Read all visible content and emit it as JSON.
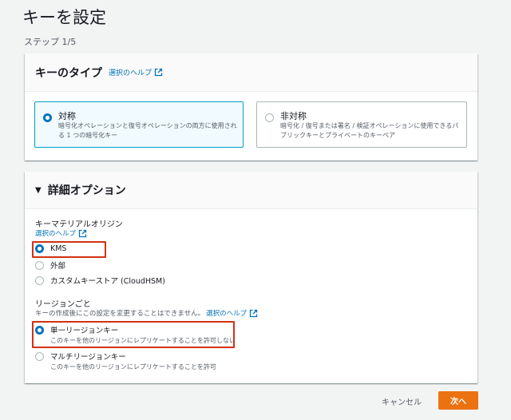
{
  "page": {
    "title": "キーを設定",
    "step": "ステップ 1/5"
  },
  "key_type": {
    "title": "キーのタイプ",
    "help_link": "選択のヘルプ",
    "options": [
      {
        "title": "対称",
        "description": "暗号化オペレーションと復号オペレーションの両方に使用される 1 つの暗号化キー",
        "selected": true
      },
      {
        "title": "非対称",
        "description": "暗号化 / 復号または署名 / 検証オペレーションに使用できるパブリックキーとプライベートのキーペア",
        "selected": false
      }
    ]
  },
  "advanced": {
    "title": "詳細オプション",
    "origin": {
      "label": "キーマテリアルオリジン",
      "help_link": "選択のヘルプ",
      "options": [
        {
          "label": "KMS",
          "selected": true
        },
        {
          "label": "外部",
          "selected": false
        },
        {
          "label": "カスタムキーストア (CloudHSM)",
          "selected": false
        }
      ]
    },
    "regionality": {
      "label": "リージョンごと",
      "description": "キーの作成後にこの設定を変更することはできません。",
      "help_link": "選択のヘルプ",
      "options": [
        {
          "label": "単一リージョンキー",
          "description": "このキーを他のリージョンにレプリケートすることを許可しない",
          "selected": true
        },
        {
          "label": "マルチリージョンキー",
          "description": "このキーを他のリージョンにレプリケートすることを許可",
          "selected": false
        }
      ]
    }
  },
  "footer": {
    "cancel_label": "キャンセル",
    "next_label": "次へ"
  },
  "colors": {
    "accent": "#0073bb",
    "primary_button": "#ec7211",
    "highlight": "#d13212"
  }
}
